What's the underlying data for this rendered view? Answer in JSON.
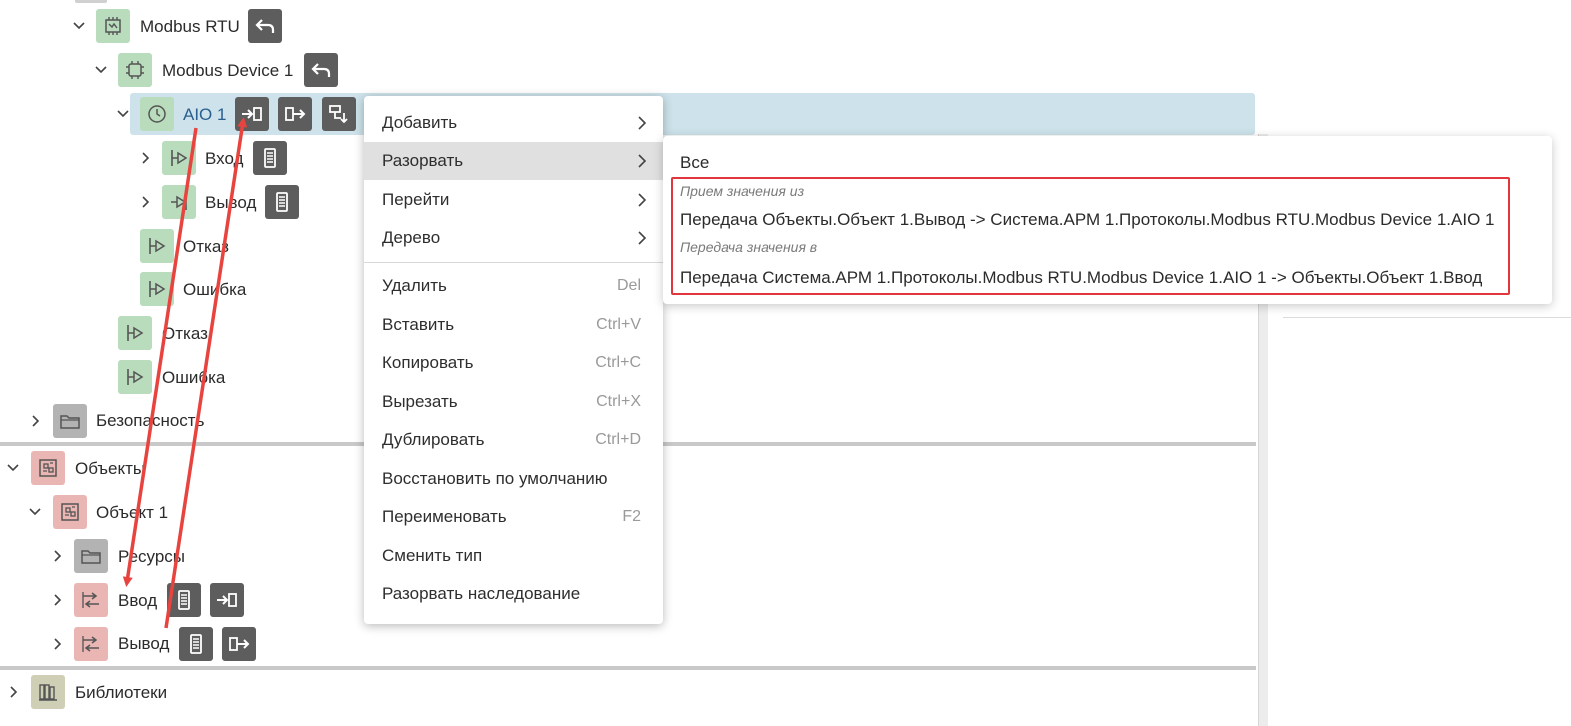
{
  "tree": {
    "modbus_rtu": "Modbus RTU",
    "modbus_device": "Modbus Device 1",
    "aio": "AIO 1",
    "input": "Вход",
    "output": "Вывод",
    "fault_inner": "Отказ",
    "error_inner": "Ошибка",
    "fault": "Отказ",
    "error": "Ошибка",
    "security": "Безопасность",
    "objects": "Объекты",
    "object1": "Объект 1",
    "resources": "Ресурсы",
    "obj_input": "Ввод",
    "obj_output": "Вывод",
    "libraries": "Библиотеки"
  },
  "context_menu": {
    "items": [
      {
        "label": "Добавить",
        "has_submenu": true
      },
      {
        "label": "Разорвать",
        "has_submenu": true,
        "active": true
      },
      {
        "label": "Перейти",
        "has_submenu": true
      },
      {
        "label": "Дерево",
        "has_submenu": true
      },
      {
        "label": "Удалить",
        "shortcut": "Del"
      },
      {
        "label": "Вставить",
        "shortcut": "Ctrl+V"
      },
      {
        "label": "Копировать",
        "shortcut": "Ctrl+C"
      },
      {
        "label": "Вырезать",
        "shortcut": "Ctrl+X"
      },
      {
        "label": "Дублировать",
        "shortcut": "Ctrl+D"
      },
      {
        "label": "Восстановить по умолчанию"
      },
      {
        "label": "Переименовать",
        "shortcut": "F2"
      },
      {
        "label": "Сменить тип"
      },
      {
        "label": "Разорвать наследование"
      }
    ]
  },
  "submenu": {
    "all": "Все",
    "receive_header": "Прием значения из",
    "receive_item": "Передача Объекты.Объект 1.Вывод -> Система.АРМ 1.Протоколы.Modbus RTU.Modbus Device 1.AIO 1",
    "send_header": "Передача значения в",
    "send_item": "Передача Система.АРМ 1.Протоколы.Modbus RTU.Modbus Device 1.AIO 1 -> Объекты.Объект 1.Ввод"
  },
  "colors": {
    "selection": "#cde2ea",
    "highlight_box": "#e0363c",
    "annotation_arrow": "#e8443f",
    "node_green": "#b9dcbd",
    "node_pink": "#e9b6b3",
    "dark_button": "#5d5d5d"
  },
  "icons": [
    "chevron-down-icon",
    "chevron-right-icon",
    "protocol-icon",
    "chip-icon",
    "clock-icon",
    "undo-icon",
    "input-link-icon",
    "output-link-icon",
    "cascade-icon",
    "signal-icon",
    "document-icon",
    "folder-icon",
    "object-icon",
    "io-icon",
    "library-icon"
  ]
}
